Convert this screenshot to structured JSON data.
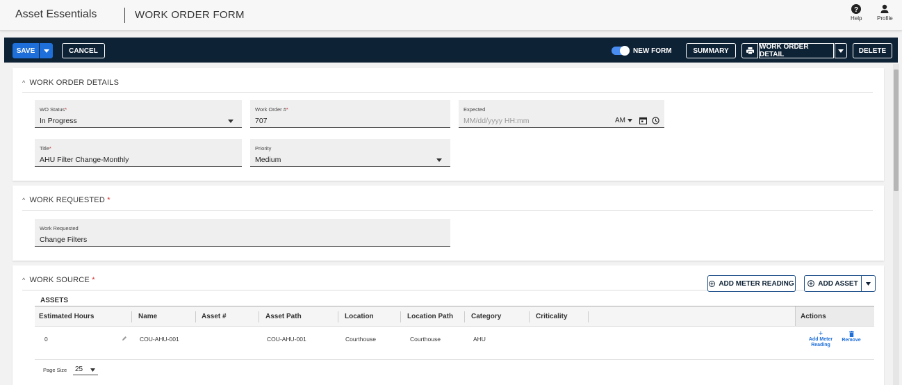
{
  "app": {
    "name": "Asset Essentials",
    "page_title": "WORK ORDER FORM"
  },
  "header_actions": {
    "help_label": "Help",
    "profile_label": "Profile"
  },
  "toolbar": {
    "save_label": "SAVE",
    "cancel_label": "CANCEL",
    "new_form_label": "NEW FORM",
    "new_form_enabled": true,
    "summary_label": "SUMMARY",
    "work_order_detail_label": "WORK ORDER DETAIL",
    "delete_label": "DELETE"
  },
  "work_order_details": {
    "header": "WORK ORDER DETAILS",
    "wo_status": {
      "label": "WO Status",
      "value": "In Progress"
    },
    "work_order_number": {
      "label": "Work Order #",
      "value": "707"
    },
    "expected": {
      "label": "Expected",
      "placeholder": "MM/dd/yyyy HH:mm",
      "ampm": "AM"
    },
    "title": {
      "label": "Title",
      "value": "AHU Filter Change-Monthly"
    },
    "priority": {
      "label": "Priority",
      "value": "Medium"
    }
  },
  "work_requested": {
    "header": "WORK REQUESTED",
    "field": {
      "label": "Work Requested",
      "value": "Change Filters"
    }
  },
  "work_source": {
    "header": "WORK SOURCE",
    "add_meter_reading_label": "ADD METER READING",
    "add_asset_label": "ADD ASSET",
    "assets_label": "ASSETS",
    "columns": [
      "Estimated Hours",
      "Name",
      "Asset #",
      "Asset Path",
      "Location",
      "Location Path",
      "Category",
      "Criticality",
      "Actions"
    ],
    "rows": [
      {
        "estimated_hours": "0",
        "name": "COU-AHU-001",
        "asset_number": "",
        "asset_path": "COU-AHU-001",
        "location": "Courthouse",
        "location_path": "Courthouse",
        "category": "AHU",
        "criticality": ""
      }
    ],
    "row_actions": {
      "add_meter_reading": "Add Meter Reading",
      "remove": "Remove"
    },
    "page_size_label": "Page Size",
    "page_size_value": "25"
  },
  "colors": {
    "toolbar_bg": "#0e2235",
    "primary": "#1e6fd9",
    "required": "#d32f2f"
  }
}
